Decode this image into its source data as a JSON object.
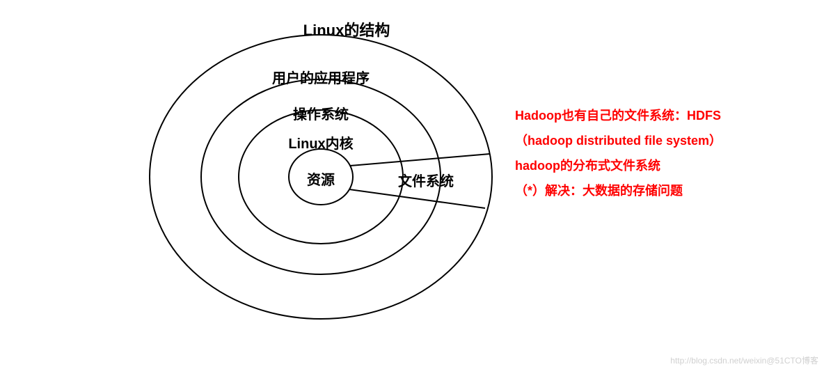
{
  "title": "Linux的结构",
  "rings": {
    "outer": "用户的应用程序",
    "middle": "操作系统",
    "inner": "Linux内核",
    "core": "资源"
  },
  "wedge_label": "文件系统",
  "annotation": {
    "line1": "Hadoop也有自己的文件系统：HDFS",
    "line2": "（hadoop distributed file system）",
    "line3": "hadoop的分布式文件系统",
    "line4": "（*）解决：大数据的存储问题"
  },
  "watermark": "http://blog.csdn.net/weixin@51CTO博客"
}
